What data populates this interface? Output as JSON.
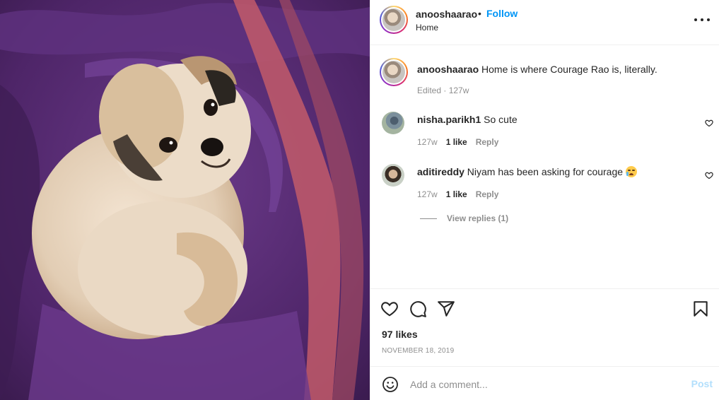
{
  "header": {
    "username": "anooshaarao",
    "separator": "•",
    "follow_label": "Follow",
    "location": "Home"
  },
  "caption": {
    "username": "anooshaarao",
    "text": "Home is where Courage Rao is, literally.",
    "meta": "Edited · 127w"
  },
  "comments": [
    {
      "username": "nisha.parikh1",
      "text": "So cute",
      "age": "127w",
      "likes": "1 like",
      "reply_label": "Reply"
    },
    {
      "username": "aditireddy",
      "text": "Niyam has been asking for courage",
      "emoji": "loudly-crying-face",
      "age": "127w",
      "likes": "1 like",
      "reply_label": "Reply"
    }
  ],
  "view_replies_label": "View replies (1)",
  "actions": {
    "likes": "97 likes",
    "date": "NOVEMBER 18, 2019",
    "icons": [
      "heart-icon",
      "comment-icon",
      "share-icon",
      "bookmark-icon"
    ]
  },
  "comment_box": {
    "placeholder": "Add a comment...",
    "post_label": "Post"
  },
  "colors": {
    "link_blue": "#0095f6",
    "post_disabled": "#b2dffc",
    "muted": "#8e8e8e",
    "text": "#262626"
  }
}
